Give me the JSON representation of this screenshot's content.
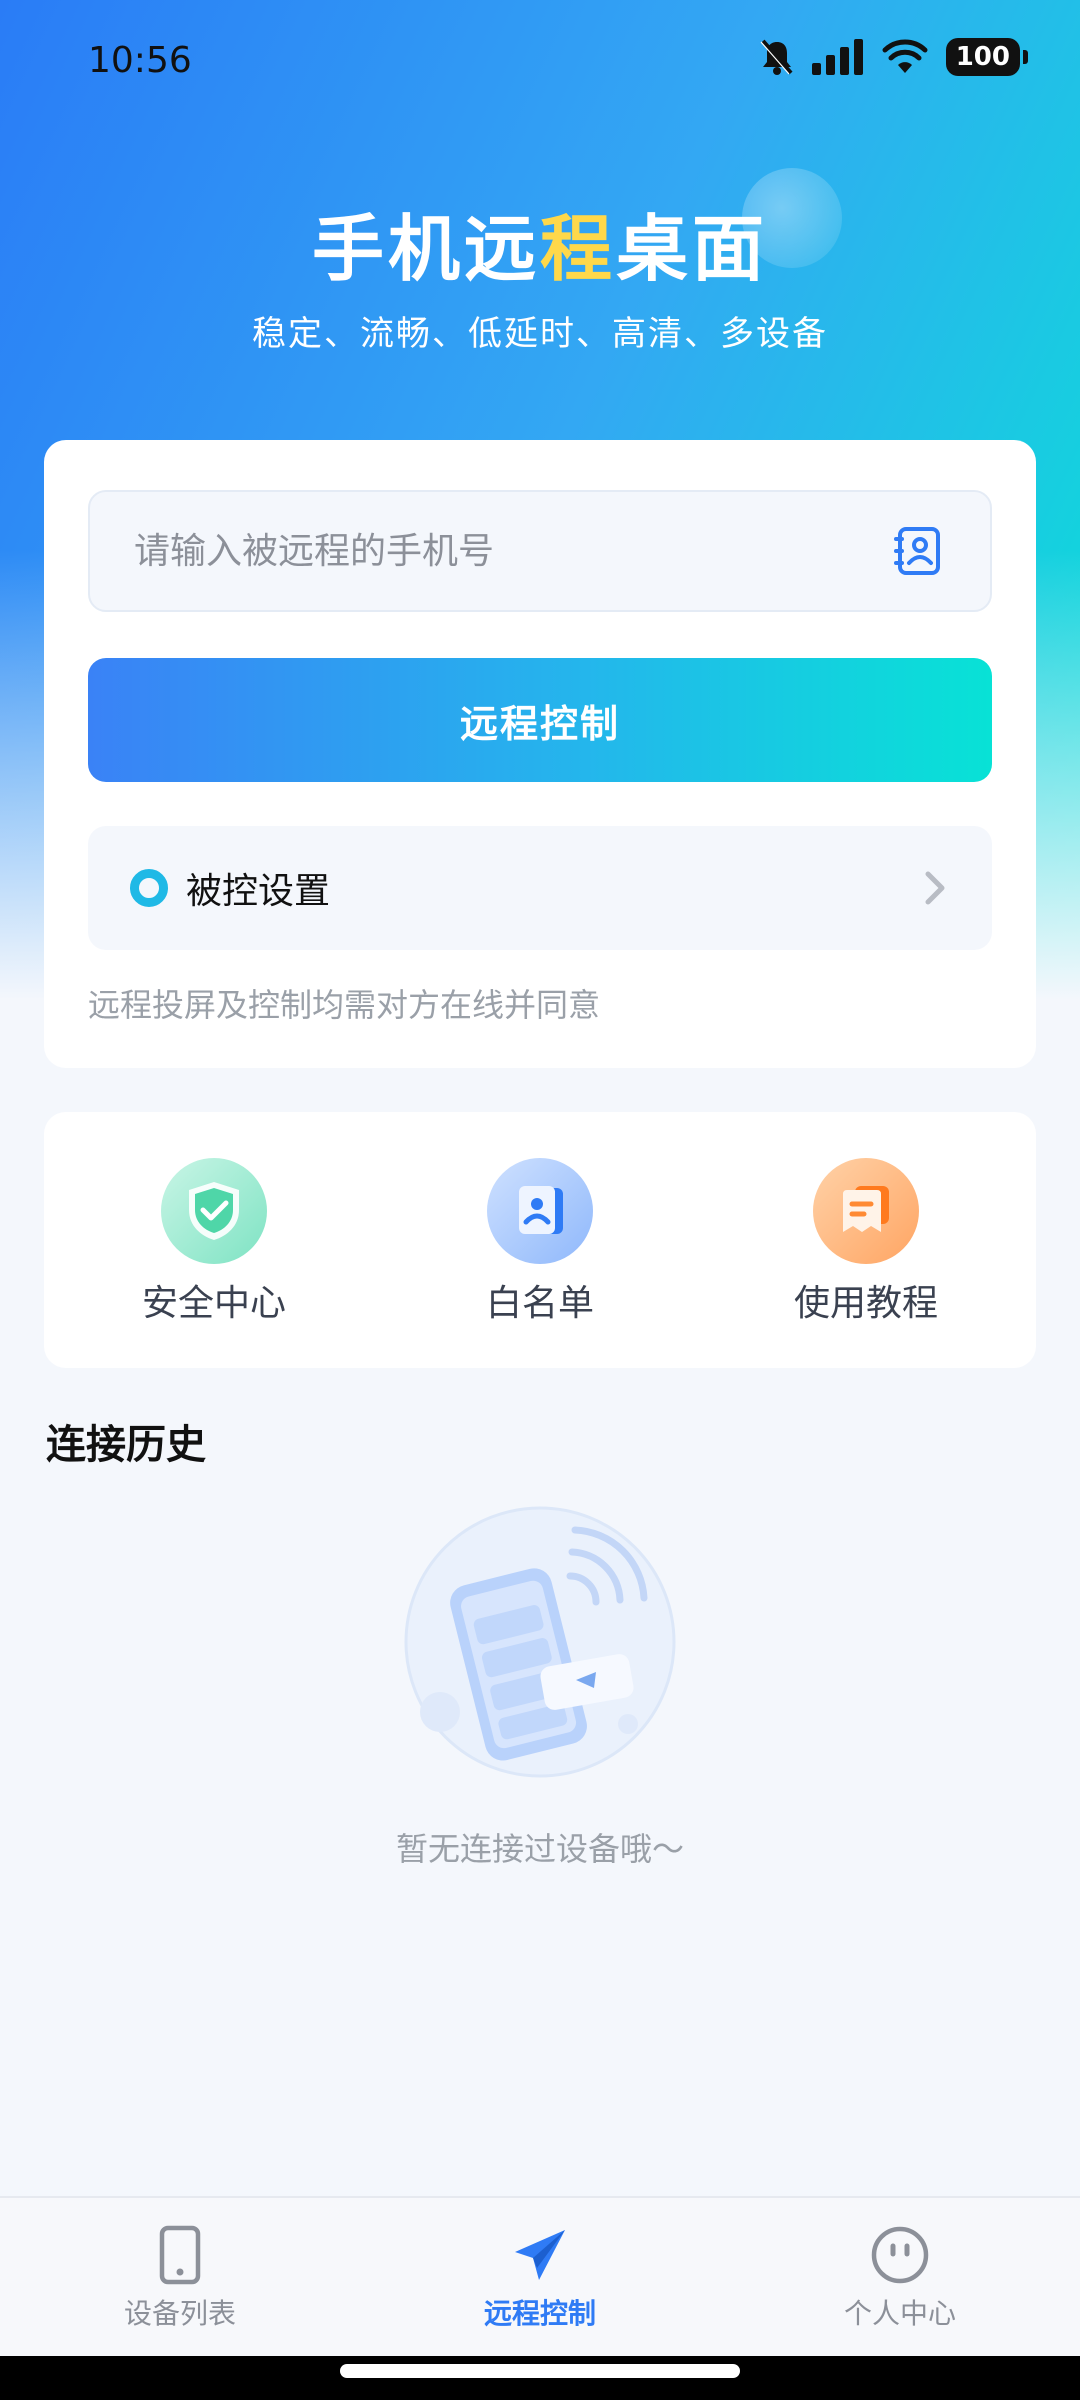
{
  "status_bar": {
    "time": "10:56",
    "battery": "100",
    "icons": [
      "bell-mute-icon",
      "signal-icon",
      "wifi-icon",
      "battery-icon"
    ]
  },
  "hero": {
    "title_part1": "手机远",
    "title_accent": "程",
    "title_part2": "桌面",
    "subtitle": "稳定、流畅、低延时、高清、多设备"
  },
  "main": {
    "phone_placeholder": "请输入被远程的手机号",
    "remote_button": "远程控制",
    "settings_label": "被控设置",
    "hint": "远程投屏及控制均需对方在线并同意"
  },
  "features": [
    {
      "label": "安全中心",
      "icon": "shield-check-icon"
    },
    {
      "label": "白名单",
      "icon": "contact-card-icon"
    },
    {
      "label": "使用教程",
      "icon": "tutorial-doc-icon"
    }
  ],
  "history": {
    "title": "连接历史",
    "empty_text": "暂无连接过设备哦～"
  },
  "tabs": [
    {
      "label": "设备列表",
      "icon": "tablet-icon",
      "active": false
    },
    {
      "label": "远程控制",
      "icon": "paper-plane-icon",
      "active": true
    },
    {
      "label": "个人中心",
      "icon": "face-icon",
      "active": false
    }
  ],
  "colors": {
    "brand_blue": "#2f7bf5",
    "brand_cyan": "#08e2d6",
    "title_accent": "#ffd84a"
  }
}
